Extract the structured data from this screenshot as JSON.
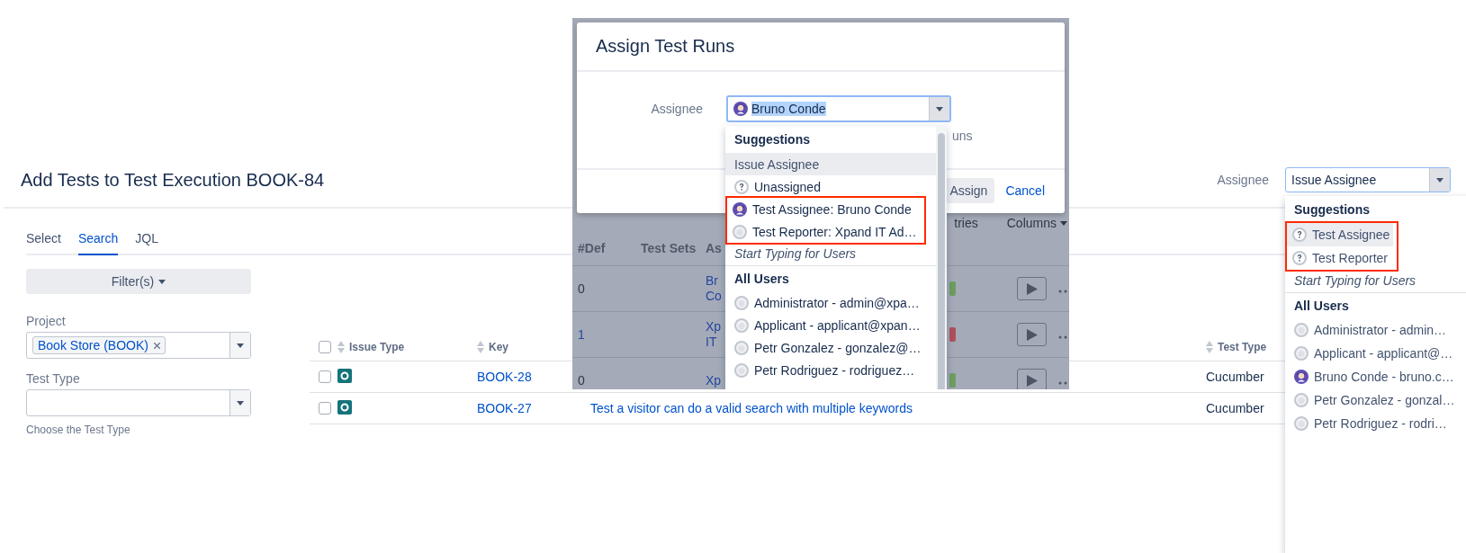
{
  "page_title": "Add Tests to Test Execution BOOK-84",
  "assignee_picker": {
    "label": "Assignee",
    "value": "Issue Assignee",
    "dropdown": {
      "sections": [
        {
          "heading": "Suggestions",
          "items": [
            {
              "label": "Test Assignee",
              "kind": "unknown",
              "selected": true,
              "highlighted": true
            },
            {
              "label": "Test Reporter",
              "kind": "unknown",
              "selected": false,
              "highlighted": true
            }
          ],
          "hint": "Start Typing for Users"
        },
        {
          "heading": "All Users",
          "items": [
            {
              "label": "Administrator - admin…",
              "kind": "default",
              "selected": false,
              "highlighted": false
            },
            {
              "label": "Applicant - applicant@…",
              "kind": "default",
              "selected": false,
              "highlighted": false
            },
            {
              "label": "Bruno Conde - bruno.c…",
              "kind": "photo",
              "selected": false,
              "highlighted": false
            },
            {
              "label": "Petr Gonzalez - gonzal…",
              "kind": "default",
              "selected": false,
              "highlighted": false
            },
            {
              "label": "Petr Rodriguez - rodri…",
              "kind": "default",
              "selected": false,
              "highlighted": false
            }
          ]
        }
      ]
    }
  },
  "tabs": [
    {
      "label": "Select",
      "selected": false
    },
    {
      "label": "Search",
      "selected": true
    },
    {
      "label": "JQL",
      "selected": false
    }
  ],
  "filter_button": {
    "label": "Filter(s)"
  },
  "fields": [
    {
      "label": "Project",
      "tags": [
        {
          "label": "Book Store (BOOK)"
        }
      ]
    },
    {
      "label": "Test Type",
      "help": "Choose the Test Type"
    }
  ],
  "table": {
    "all_checked": false,
    "columns": [
      "Issue Type",
      "Key",
      "Test Type"
    ],
    "rows": [
      {
        "checked": false,
        "key": "BOOK-28",
        "test_type": "Cucumber"
      },
      {
        "checked": false,
        "key": "BOOK-27",
        "summary": "Test a visitor can do a valid search with multiple keywords",
        "test_type": "Cucumber"
      }
    ]
  },
  "assign_dialog": {
    "background": {
      "toolbar": [
        "tries",
        "Columns"
      ],
      "columns": [
        "#Def",
        "Test Sets",
        "As"
      ],
      "rows": [
        {
          "defects": "0",
          "defects_link": false,
          "assignee_lines": [
            "Br",
            "Co"
          ],
          "color": "#6d9e5f"
        },
        {
          "defects": "1",
          "defects_link": true,
          "assignee_lines": [
            "Xp",
            "IT"
          ],
          "color": "#b0505a"
        },
        {
          "defects": "0",
          "defects_link": false,
          "assignee_lines": [
            "Xp"
          ],
          "color": "#6d9e5f"
        }
      ]
    },
    "title": "Assign Test Runs",
    "assignee": {
      "label": "Assignee",
      "value": "Bruno Conde",
      "avatar": {
        "kind": "photo"
      },
      "text_selected": true,
      "dropdown": {
        "sections": [
          {
            "heading": "Suggestions",
            "items": [
              {
                "label": "Issue Assignee",
                "kind": "plain",
                "selected": true,
                "highlighted": false
              },
              {
                "label": "Unassigned",
                "kind": "unknown",
                "selected": false,
                "highlighted": false
              },
              {
                "label": "Test Assignee: Bruno Conde",
                "kind": "photo",
                "selected": false,
                "highlighted": true
              },
              {
                "label": "Test Reporter: Xpand IT Ad…",
                "kind": "default",
                "selected": false,
                "highlighted": true
              }
            ],
            "hint": "Start Typing for Users"
          },
          {
            "heading": "All Users",
            "items": [
              {
                "label": "Administrator - admin@xpa…",
                "kind": "default",
                "selected": false,
                "highlighted": false
              },
              {
                "label": "Applicant - applicant@xpan…",
                "kind": "default",
                "selected": false,
                "highlighted": false
              },
              {
                "label": "Petr Gonzalez - gonzalez@…",
                "kind": "default",
                "selected": false,
                "highlighted": false
              },
              {
                "label": "Petr Rodriguez - rodriguez…",
                "kind": "default",
                "selected": false,
                "highlighted": false
              }
            ]
          }
        ]
      }
    },
    "note": "uns",
    "buttons": [
      {
        "label": "Assign",
        "kind": "secondary"
      },
      {
        "label": "Cancel",
        "kind": "link"
      }
    ]
  }
}
